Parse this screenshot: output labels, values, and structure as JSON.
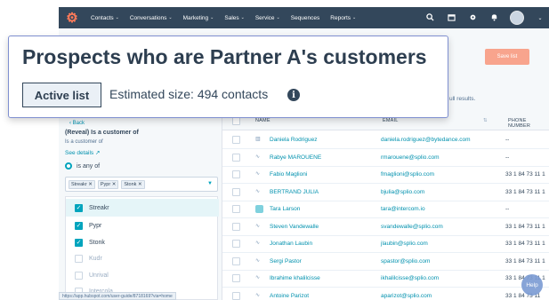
{
  "nav": {
    "items": [
      {
        "label": "Contacts",
        "has_dropdown": true
      },
      {
        "label": "Conversations",
        "has_dropdown": true
      },
      {
        "label": "Marketing",
        "has_dropdown": true
      },
      {
        "label": "Sales",
        "has_dropdown": true
      },
      {
        "label": "Service",
        "has_dropdown": true
      },
      {
        "label": "Sequences",
        "has_dropdown": false
      },
      {
        "label": "Reports",
        "has_dropdown": true
      }
    ],
    "icons": [
      "search-icon",
      "marketplace-icon",
      "settings-icon",
      "notifications-icon",
      "avatar"
    ]
  },
  "header": {
    "save_label": "Save list",
    "results_text": "ull results."
  },
  "overlay": {
    "title": "Prospects who are Partner A's customers",
    "badge": "Active list",
    "estimated_size": "Estimated size: 494 contacts",
    "info_glyph": "i"
  },
  "filter": {
    "back_label": "Back",
    "title": "(Reveal) Is a customer of",
    "subtitle": "Is a customer of",
    "see_details": "See details",
    "operator": "is any of",
    "selected_tags": [
      "Streakr",
      "Pypr",
      "Stonk"
    ],
    "options": [
      {
        "label": "Streakr",
        "checked": true
      },
      {
        "label": "Pypr",
        "checked": true
      },
      {
        "label": "Stonk",
        "checked": true
      },
      {
        "label": "Kudr",
        "checked": false
      },
      {
        "label": "Unrival",
        "checked": false
      },
      {
        "label": "Intercola",
        "checked": false
      }
    ]
  },
  "table": {
    "headers": {
      "name": "NAME",
      "email": "EMAIL",
      "phone": "PHONE NUMBER"
    },
    "rows": [
      {
        "name": "Daniela Rodriguez",
        "email": "daniela.rodriguez@bytedance.com",
        "phone": "--",
        "icon": "company-icon"
      },
      {
        "name": "Rabye MAROUENE",
        "email": "rmarouene@splio.com",
        "phone": "--",
        "icon": "splio-icon"
      },
      {
        "name": "Fabio Maglioni",
        "email": "fmaglioni@splio.com",
        "phone": "33 1 84 73 11 1",
        "icon": "splio-icon"
      },
      {
        "name": "BERTRAND JULIA",
        "email": "bjulia@splio.com",
        "phone": "33 1 84 73 11 1",
        "icon": "splio-icon"
      },
      {
        "name": "Tara Larson",
        "email": "tara@intercom.io",
        "phone": "--",
        "icon": "intercom-icon"
      },
      {
        "name": "Steven Vandewalle",
        "email": "svandewalle@splio.com",
        "phone": "33 1 84 73 11 1",
        "icon": "splio-icon"
      },
      {
        "name": "Jonathan Laubin",
        "email": "jlaubin@splio.com",
        "phone": "33 1 84 73 11 1",
        "icon": "splio-icon"
      },
      {
        "name": "Sergi Pastor",
        "email": "spastor@splio.com",
        "phone": "33 1 84 73 11 1",
        "icon": "splio-icon"
      },
      {
        "name": "Ibrahime khalilcisse",
        "email": "ikhalilcisse@splio.com",
        "phone": "33 1 84 73 11 1",
        "icon": "splio-icon"
      },
      {
        "name": "Antoine Parizot",
        "email": "aparizot@splio.com",
        "phone": "33 1 84 73 11",
        "icon": "splio-icon"
      }
    ]
  },
  "status_url": "https://app.hubspot.com/user-guide/8718169?via=home",
  "help_label": "Help",
  "colors": {
    "nav_bg": "#33475b",
    "accent_orange": "#ff7a59",
    "save_button": "#f8a48d",
    "link": "#0091ae",
    "checkbox": "#00a4bd"
  }
}
